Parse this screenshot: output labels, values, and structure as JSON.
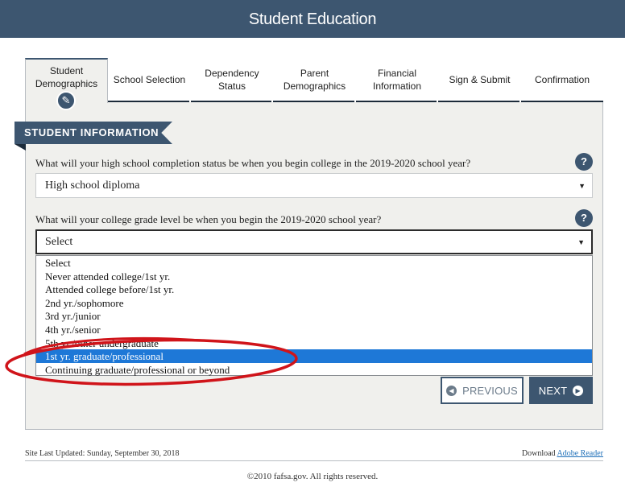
{
  "header": {
    "title": "Student Education"
  },
  "tabs": [
    {
      "label": "Student\nDemographics",
      "active": true
    },
    {
      "label": "School Selection"
    },
    {
      "label": "Dependency Status"
    },
    {
      "label": "Parent\nDemographics"
    },
    {
      "label": "Financial\nInformation"
    },
    {
      "label": "Sign & Submit"
    },
    {
      "label": "Confirmation"
    }
  ],
  "section": {
    "title": "STUDENT INFORMATION"
  },
  "questions": [
    {
      "label": "What will your high school completion status be when you begin college in the 2019-2020 school year?",
      "value": "High school diploma",
      "help": "?"
    },
    {
      "label": "What will your college grade level be when you begin the 2019-2020 school year?",
      "value": "Select",
      "help": "?"
    }
  ],
  "dropdown": {
    "options": [
      "Select",
      "Never attended college/1st yr.",
      "Attended college before/1st yr.",
      "2nd yr./sophomore",
      "3rd yr./junior",
      "4th yr./senior",
      "5th yr./other undergraduate",
      "1st yr. graduate/professional",
      "Continuing graduate/professional or beyond"
    ],
    "highlighted_index": 7
  },
  "buttons": {
    "previous": "PREVIOUS",
    "next": "NEXT"
  },
  "annotation": {
    "color": "#d0141a"
  },
  "footer": {
    "updated": "Site Last Updated: Sunday, September 30, 2018",
    "download_prefix": "Download",
    "download_link": "Adobe Reader",
    "copyright": "©2010 fafsa.gov. All rights reserved."
  },
  "colors": {
    "primary": "#3d5670",
    "highlight": "#1e78d7",
    "panel": "#f0f0ed"
  }
}
